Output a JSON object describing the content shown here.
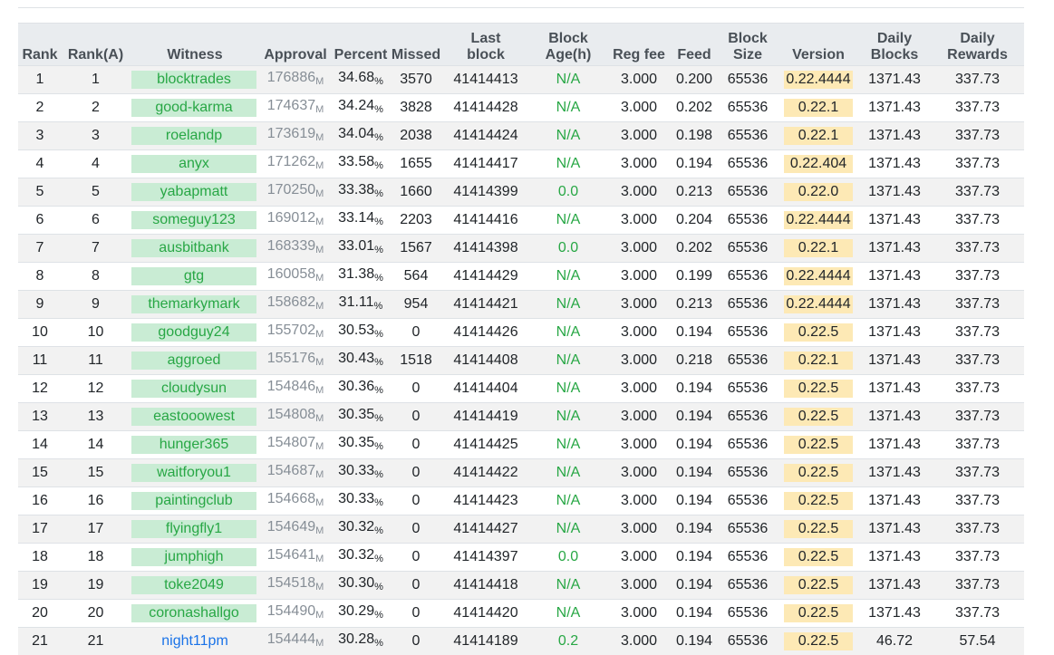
{
  "columns": [
    "Rank",
    "Rank(A)",
    "Witness",
    "Approval",
    "Percent",
    "Missed",
    "Last block",
    "Block Age(h)",
    "Reg fee",
    "Feed",
    "Block Size",
    "Version",
    "Daily Blocks",
    "Daily Rewards"
  ],
  "approval_suffix": "M",
  "percent_suffix": "%",
  "rows": [
    {
      "rank": "1",
      "rank_a": "1",
      "witness": "blocktrades",
      "approval": "176886",
      "percent": "34.68",
      "missed": "3570",
      "last_block": "41414413",
      "block_age": "N/A",
      "reg_fee": "3.000",
      "feed": "0.200",
      "block_size": "65536",
      "version": "0.22.4444",
      "daily_blocks": "1371.43",
      "daily_rewards": "337.73"
    },
    {
      "rank": "2",
      "rank_a": "2",
      "witness": "good-karma",
      "approval": "174637",
      "percent": "34.24",
      "missed": "3828",
      "last_block": "41414428",
      "block_age": "N/A",
      "reg_fee": "3.000",
      "feed": "0.202",
      "block_size": "65536",
      "version": "0.22.1",
      "daily_blocks": "1371.43",
      "daily_rewards": "337.73"
    },
    {
      "rank": "3",
      "rank_a": "3",
      "witness": "roelandp",
      "approval": "173619",
      "percent": "34.04",
      "missed": "2038",
      "last_block": "41414424",
      "block_age": "N/A",
      "reg_fee": "3.000",
      "feed": "0.198",
      "block_size": "65536",
      "version": "0.22.1",
      "daily_blocks": "1371.43",
      "daily_rewards": "337.73"
    },
    {
      "rank": "4",
      "rank_a": "4",
      "witness": "anyx",
      "approval": "171262",
      "percent": "33.58",
      "missed": "1655",
      "last_block": "41414417",
      "block_age": "N/A",
      "reg_fee": "3.000",
      "feed": "0.194",
      "block_size": "65536",
      "version": "0.22.404",
      "daily_blocks": "1371.43",
      "daily_rewards": "337.73"
    },
    {
      "rank": "5",
      "rank_a": "5",
      "witness": "yabapmatt",
      "approval": "170250",
      "percent": "33.38",
      "missed": "1660",
      "last_block": "41414399",
      "block_age": "0.0",
      "reg_fee": "3.000",
      "feed": "0.213",
      "block_size": "65536",
      "version": "0.22.0",
      "daily_blocks": "1371.43",
      "daily_rewards": "337.73"
    },
    {
      "rank": "6",
      "rank_a": "6",
      "witness": "someguy123",
      "approval": "169012",
      "percent": "33.14",
      "missed": "2203",
      "last_block": "41414416",
      "block_age": "N/A",
      "reg_fee": "3.000",
      "feed": "0.204",
      "block_size": "65536",
      "version": "0.22.4444",
      "daily_blocks": "1371.43",
      "daily_rewards": "337.73"
    },
    {
      "rank": "7",
      "rank_a": "7",
      "witness": "ausbitbank",
      "approval": "168339",
      "percent": "33.01",
      "missed": "1567",
      "last_block": "41414398",
      "block_age": "0.0",
      "reg_fee": "3.000",
      "feed": "0.202",
      "block_size": "65536",
      "version": "0.22.1",
      "daily_blocks": "1371.43",
      "daily_rewards": "337.73"
    },
    {
      "rank": "8",
      "rank_a": "8",
      "witness": "gtg",
      "approval": "160058",
      "percent": "31.38",
      "missed": "564",
      "last_block": "41414429",
      "block_age": "N/A",
      "reg_fee": "3.000",
      "feed": "0.199",
      "block_size": "65536",
      "version": "0.22.4444",
      "daily_blocks": "1371.43",
      "daily_rewards": "337.73"
    },
    {
      "rank": "9",
      "rank_a": "9",
      "witness": "themarkymark",
      "approval": "158682",
      "percent": "31.11",
      "missed": "954",
      "last_block": "41414421",
      "block_age": "N/A",
      "reg_fee": "3.000",
      "feed": "0.213",
      "block_size": "65536",
      "version": "0.22.4444",
      "daily_blocks": "1371.43",
      "daily_rewards": "337.73"
    },
    {
      "rank": "10",
      "rank_a": "10",
      "witness": "goodguy24",
      "approval": "155702",
      "percent": "30.53",
      "missed": "0",
      "last_block": "41414426",
      "block_age": "N/A",
      "reg_fee": "3.000",
      "feed": "0.194",
      "block_size": "65536",
      "version": "0.22.5",
      "daily_blocks": "1371.43",
      "daily_rewards": "337.73"
    },
    {
      "rank": "11",
      "rank_a": "11",
      "witness": "aggroed",
      "approval": "155176",
      "percent": "30.43",
      "missed": "1518",
      "last_block": "41414408",
      "block_age": "N/A",
      "reg_fee": "3.000",
      "feed": "0.218",
      "block_size": "65536",
      "version": "0.22.1",
      "daily_blocks": "1371.43",
      "daily_rewards": "337.73"
    },
    {
      "rank": "12",
      "rank_a": "12",
      "witness": "cloudysun",
      "approval": "154846",
      "percent": "30.36",
      "missed": "0",
      "last_block": "41414404",
      "block_age": "N/A",
      "reg_fee": "3.000",
      "feed": "0.194",
      "block_size": "65536",
      "version": "0.22.5",
      "daily_blocks": "1371.43",
      "daily_rewards": "337.73"
    },
    {
      "rank": "13",
      "rank_a": "13",
      "witness": "eastooowest",
      "approval": "154808",
      "percent": "30.35",
      "missed": "0",
      "last_block": "41414419",
      "block_age": "N/A",
      "reg_fee": "3.000",
      "feed": "0.194",
      "block_size": "65536",
      "version": "0.22.5",
      "daily_blocks": "1371.43",
      "daily_rewards": "337.73"
    },
    {
      "rank": "14",
      "rank_a": "14",
      "witness": "hunger365",
      "approval": "154807",
      "percent": "30.35",
      "missed": "0",
      "last_block": "41414425",
      "block_age": "N/A",
      "reg_fee": "3.000",
      "feed": "0.194",
      "block_size": "65536",
      "version": "0.22.5",
      "daily_blocks": "1371.43",
      "daily_rewards": "337.73"
    },
    {
      "rank": "15",
      "rank_a": "15",
      "witness": "waitforyou1",
      "approval": "154687",
      "percent": "30.33",
      "missed": "0",
      "last_block": "41414422",
      "block_age": "N/A",
      "reg_fee": "3.000",
      "feed": "0.194",
      "block_size": "65536",
      "version": "0.22.5",
      "daily_blocks": "1371.43",
      "daily_rewards": "337.73"
    },
    {
      "rank": "16",
      "rank_a": "16",
      "witness": "paintingclub",
      "approval": "154668",
      "percent": "30.33",
      "missed": "0",
      "last_block": "41414423",
      "block_age": "N/A",
      "reg_fee": "3.000",
      "feed": "0.194",
      "block_size": "65536",
      "version": "0.22.5",
      "daily_blocks": "1371.43",
      "daily_rewards": "337.73"
    },
    {
      "rank": "17",
      "rank_a": "17",
      "witness": "flyingfly1",
      "approval": "154649",
      "percent": "30.32",
      "missed": "0",
      "last_block": "41414427",
      "block_age": "N/A",
      "reg_fee": "3.000",
      "feed": "0.194",
      "block_size": "65536",
      "version": "0.22.5",
      "daily_blocks": "1371.43",
      "daily_rewards": "337.73"
    },
    {
      "rank": "18",
      "rank_a": "18",
      "witness": "jumphigh",
      "approval": "154641",
      "percent": "30.32",
      "missed": "0",
      "last_block": "41414397",
      "block_age": "0.0",
      "reg_fee": "3.000",
      "feed": "0.194",
      "block_size": "65536",
      "version": "0.22.5",
      "daily_blocks": "1371.43",
      "daily_rewards": "337.73"
    },
    {
      "rank": "19",
      "rank_a": "19",
      "witness": "toke2049",
      "approval": "154518",
      "percent": "30.30",
      "missed": "0",
      "last_block": "41414418",
      "block_age": "N/A",
      "reg_fee": "3.000",
      "feed": "0.194",
      "block_size": "65536",
      "version": "0.22.5",
      "daily_blocks": "1371.43",
      "daily_rewards": "337.73"
    },
    {
      "rank": "20",
      "rank_a": "20",
      "witness": "coronashallgo",
      "approval": "154490",
      "percent": "30.29",
      "missed": "0",
      "last_block": "41414420",
      "block_age": "N/A",
      "reg_fee": "3.000",
      "feed": "0.194",
      "block_size": "65536",
      "version": "0.22.5",
      "daily_blocks": "1371.43",
      "daily_rewards": "337.73"
    },
    {
      "rank": "21",
      "rank_a": "21",
      "witness": "night11pm",
      "approval": "154444",
      "percent": "30.28",
      "missed": "0",
      "last_block": "41414189",
      "block_age": "0.2",
      "reg_fee": "3.000",
      "feed": "0.194",
      "block_size": "65536",
      "version": "0.22.5",
      "daily_blocks": "46.72",
      "daily_rewards": "57.54",
      "link_style": true
    }
  ]
}
